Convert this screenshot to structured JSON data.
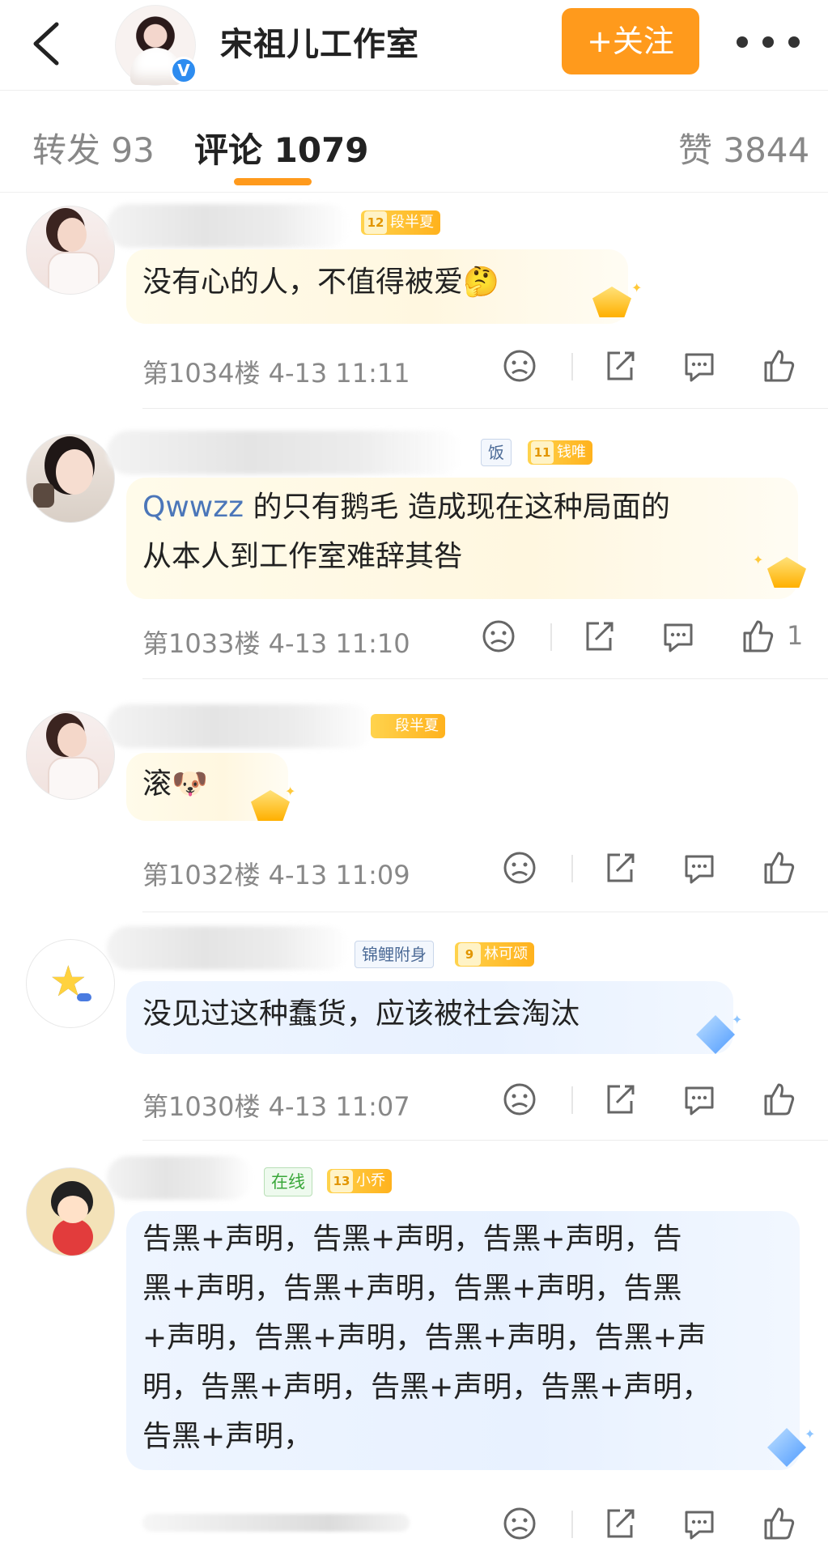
{
  "header": {
    "title": "宋祖儿工作室",
    "follow_label": "+关注",
    "verified_mark": "V"
  },
  "tabs": [
    {
      "label": "转发 93"
    },
    {
      "label": "评论 1079"
    },
    {
      "label": "赞 3844"
    }
  ],
  "colors": {
    "accent": "#ff9a1c",
    "mention": "#4b76b9",
    "rank_gold": "#ffb21d"
  },
  "comments": [
    {
      "badge_level": "12",
      "badge_name": "段半夏",
      "text": "没有心的人，不值得被爱🤔",
      "floor": "第1034楼",
      "time": "4-13 11:11",
      "likes": ""
    },
    {
      "fan_tag": "饭",
      "badge_level": "11",
      "badge_name": "钱唯",
      "mention": "Qwwzz",
      "text_line1": " 的只有鹅毛 造成现在这种局面的",
      "text_line2": "从本人到工作室难辞其咎",
      "floor": "第1033楼",
      "time": "4-13 11:10",
      "likes": "1"
    },
    {
      "badge_name": "段半夏",
      "text": "滚🐶",
      "floor": "第1032楼",
      "time": "4-13 11:09",
      "likes": ""
    },
    {
      "fan_tag": "锦鲤附身",
      "badge_level": "9",
      "badge_name": "林可颂",
      "text": "没见过这种蠢货，应该被社会淘汰",
      "floor": "第1030楼",
      "time": "4-13 11:07",
      "likes": ""
    },
    {
      "online_tag": "在线",
      "badge_level": "13",
      "badge_name": "小乔",
      "lines": [
        "告黑+声明，告黑+声明，告黑+声明，告",
        "黑+声明，告黑+声明，告黑+声明，告黑",
        "+声明，告黑+声明，告黑+声明，告黑+声",
        "明，告黑+声明，告黑+声明，告黑+声明，",
        "告黑+声明，"
      ]
    }
  ]
}
